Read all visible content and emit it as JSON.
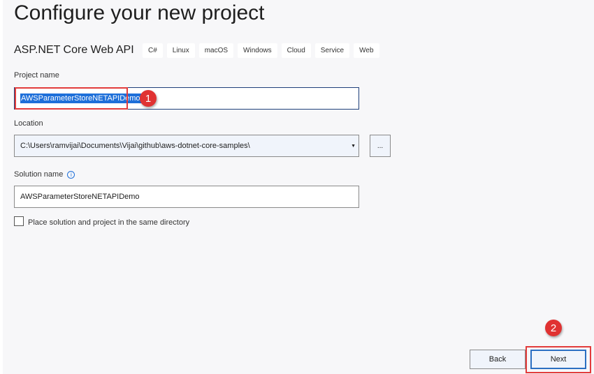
{
  "page_title": "Configure your new project",
  "template": {
    "name": "ASP.NET Core Web API",
    "tags": [
      "C#",
      "Linux",
      "macOS",
      "Windows",
      "Cloud",
      "Service",
      "Web"
    ]
  },
  "project_name": {
    "label": "Project name",
    "value": "AWSParameterStoreNETAPIDemo"
  },
  "location": {
    "label": "Location",
    "value": "C:\\Users\\ramvijai\\Documents\\Vijai\\github\\aws-dotnet-core-samples\\",
    "browse_label": "..."
  },
  "solution_name": {
    "label": "Solution name",
    "value": "AWSParameterStoreNETAPIDemo"
  },
  "same_dir": {
    "label": "Place solution and project in the same directory",
    "checked": false
  },
  "buttons": {
    "back": "Back",
    "next": "Next"
  },
  "annotations": [
    "1",
    "2"
  ]
}
